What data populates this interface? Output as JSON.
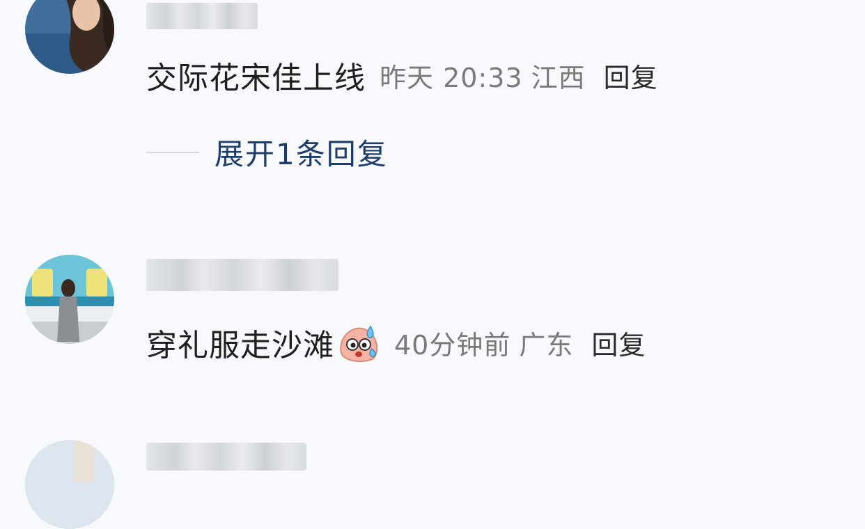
{
  "comments": [
    {
      "text": "交际花宋佳上线",
      "time": "昨天 20:33",
      "location": "江西",
      "reply_label": "回复",
      "expand_label": "展开1条回复"
    },
    {
      "text": "穿礼服走沙滩",
      "emoji": "sweating-face-emoji",
      "time": "40分钟前",
      "location": "广东",
      "reply_label": "回复"
    }
  ],
  "colors": {
    "background": "#f7f9fc",
    "comment_text": "#1f1f1f",
    "meta_text": "#7a7a7a",
    "expand_link": "#1f3d6b"
  }
}
